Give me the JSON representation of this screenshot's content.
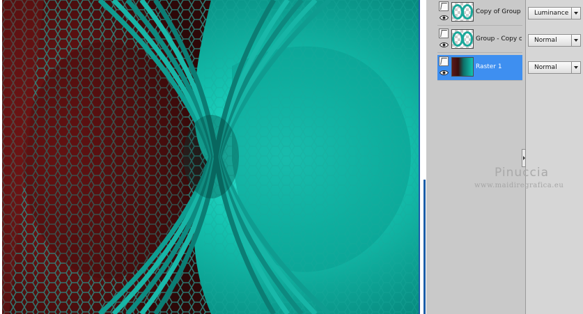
{
  "layers": [
    {
      "name": "Copy of Group",
      "blend_mode": "Luminance",
      "thumbnail": "checker-pattern",
      "selected": false
    },
    {
      "name": "Group - Copy o",
      "blend_mode": "Normal",
      "thumbnail": "checker-pattern",
      "selected": false
    },
    {
      "name": "Raster 1",
      "blend_mode": "Normal",
      "thumbnail": "raster-image",
      "selected": true
    }
  ],
  "watermark": {
    "name": "Pinuccia",
    "url": "www.maidiregrafica.eu"
  },
  "colors": {
    "selection": "#3e8ff0",
    "teal": "#13c4b1",
    "dark_red": "#6e1414",
    "canvas_border": "#1c5ea8"
  }
}
